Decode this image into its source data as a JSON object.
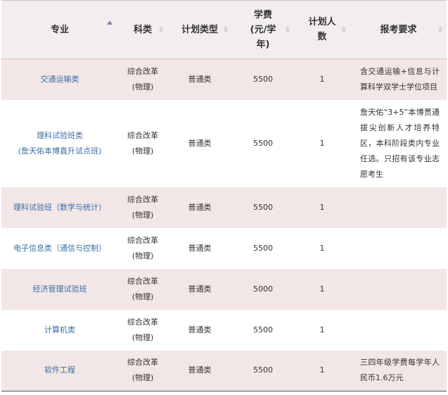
{
  "header": {
    "major": "专业",
    "subject": "科类",
    "plan_type": "计划类型",
    "tuition_line1": "学费",
    "tuition_line2": "(元/学",
    "tuition_line3": "年)",
    "plan_count_line1": "计划人",
    "plan_count_line2": "数",
    "requirements": "报考要求"
  },
  "rows": [
    {
      "major_line1": "交通运输类",
      "major_line2": "",
      "subject_line1": "综合改革",
      "subject_line2": "(物理)",
      "plan_type": "普通类",
      "tuition": "5500",
      "count": "1",
      "req": "含交通运输+信息与计算科学双学士学位项目"
    },
    {
      "major_line1": "理科试验班类",
      "major_line2": "(詹天佑本博直升试点班)",
      "subject_line1": "综合改革",
      "subject_line2": "(物理)",
      "plan_type": "普通类",
      "tuition": "5500",
      "count": "1",
      "req": "詹天佑“3+5”本博贯通拔尖创新人才培养特区，本科阶段类内专业任选。只招有该专业志愿考生"
    },
    {
      "major_line1": "理科试验班（数学与统计）",
      "major_line2": "",
      "subject_line1": "综合改革",
      "subject_line2": "(物理)",
      "plan_type": "普通类",
      "tuition": "5500",
      "count": "1",
      "req": ""
    },
    {
      "major_line1": "电子信息类（通信与控制）",
      "major_line2": "",
      "subject_line1": "综合改革",
      "subject_line2": "(物理)",
      "plan_type": "普通类",
      "tuition": "5500",
      "count": "1",
      "req": ""
    },
    {
      "major_line1": "经济管理试验班",
      "major_line2": "",
      "subject_line1": "综合改革",
      "subject_line2": "(物理)",
      "plan_type": "普通类",
      "tuition": "5000",
      "count": "1",
      "req": ""
    },
    {
      "major_line1": "计算机类",
      "major_line2": "",
      "subject_line1": "综合改革",
      "subject_line2": "(物理)",
      "plan_type": "普通类",
      "tuition": "5500",
      "count": "1",
      "req": ""
    },
    {
      "major_line1": "软件工程",
      "major_line2": "",
      "subject_line1": "综合改革",
      "subject_line2": "(物理)",
      "plan_type": "普通类",
      "tuition": "5500",
      "count": "1",
      "req": "三四年级学费每学年人民币1.6万元"
    }
  ]
}
